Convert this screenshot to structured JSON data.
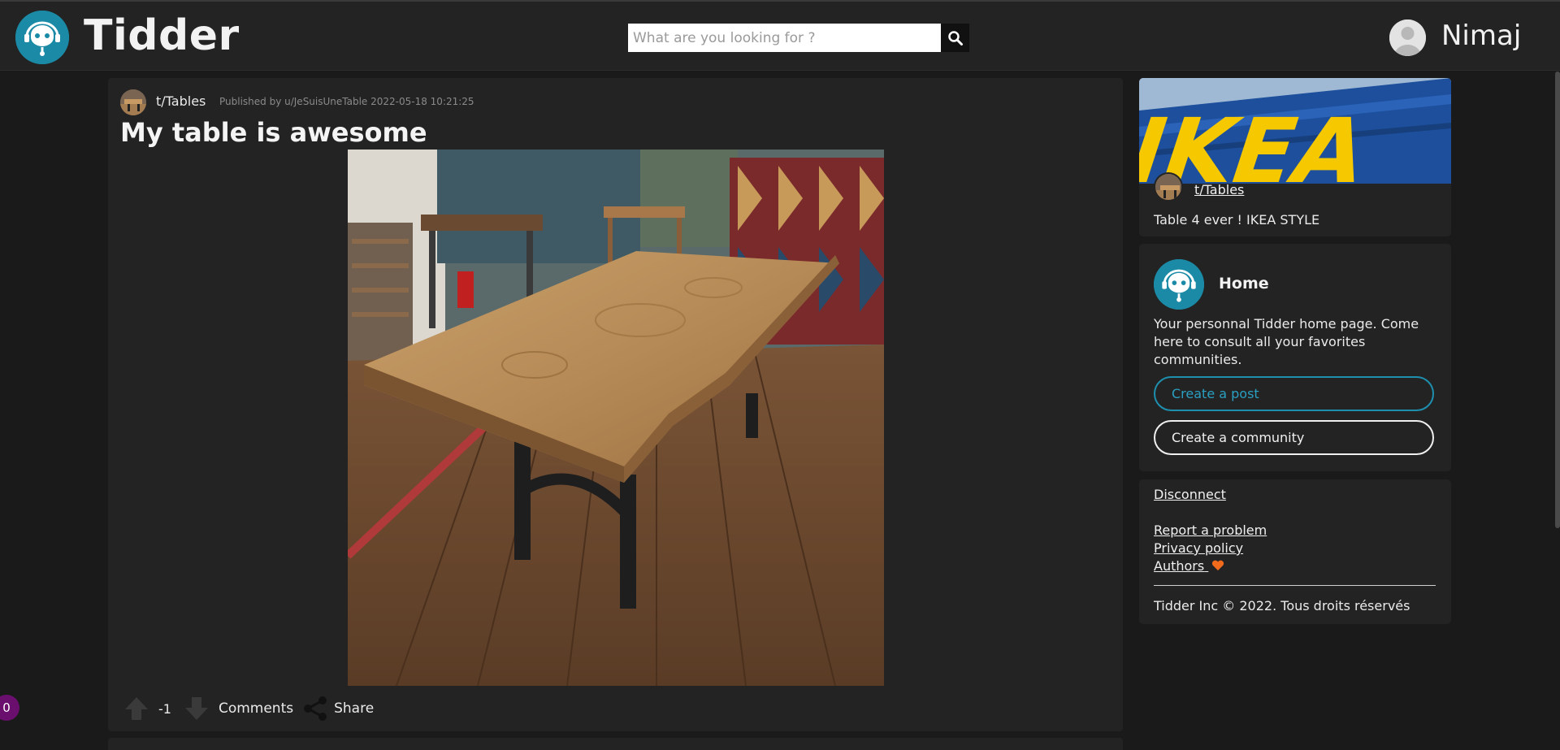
{
  "header": {
    "brand": "Tidder",
    "search_placeholder": "What are you looking for ?",
    "user_name": "Nimaj"
  },
  "post": {
    "community": "t/Tables",
    "published": "Published by u/JeSuisUneTable 2022-05-18 10:21:25",
    "title": "My table is awesome",
    "vote_count": "-1",
    "comments_label": "Comments",
    "share_label": "Share"
  },
  "sidebar": {
    "community_card": {
      "banner_text": "IKEA",
      "community": "t/Tables",
      "description": "Table 4 ever ! IKEA STYLE"
    },
    "home_card": {
      "title": "Home",
      "description": "Your personnal Tidder home page. Come here to consult all your favorites communities.",
      "create_post_label": "Create a post",
      "create_community_label": "Create a community"
    },
    "footer_card": {
      "disconnect": "Disconnect",
      "report": "Report a problem",
      "privacy": "Privacy policy",
      "authors": "Authors",
      "copyright": "Tidder Inc © 2022. Tous droits réservés"
    }
  },
  "notification_badge": "0",
  "colors": {
    "accent": "#1b8aa6",
    "background": "#1a1a1b",
    "card": "#232323",
    "heart": "#f26b1d"
  }
}
